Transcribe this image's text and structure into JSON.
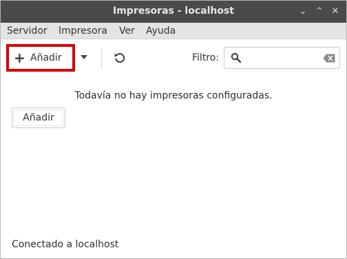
{
  "window": {
    "title": "Impresoras - localhost"
  },
  "titlebar": {
    "minimize_glyph": "⌄",
    "maximize_glyph": "⌃",
    "close_glyph": "✕"
  },
  "menubar": {
    "items": [
      {
        "label": "Servidor"
      },
      {
        "label": "Impresora"
      },
      {
        "label": "Ver"
      },
      {
        "label": "Ayuda"
      }
    ]
  },
  "toolbar": {
    "add_label": "Añadir",
    "add_icon": "plus-icon",
    "dropdown_icon": "chevron-down-icon",
    "refresh_icon": "refresh-icon",
    "filter_label": "Filtro:",
    "filter_value": "",
    "filter_placeholder": "",
    "highlight_color": "#d60000"
  },
  "main": {
    "empty_message": "Todavía no hay impresoras configuradas.",
    "add_button_label": "Añadir"
  },
  "statusbar": {
    "text": "Conectado a localhost"
  }
}
